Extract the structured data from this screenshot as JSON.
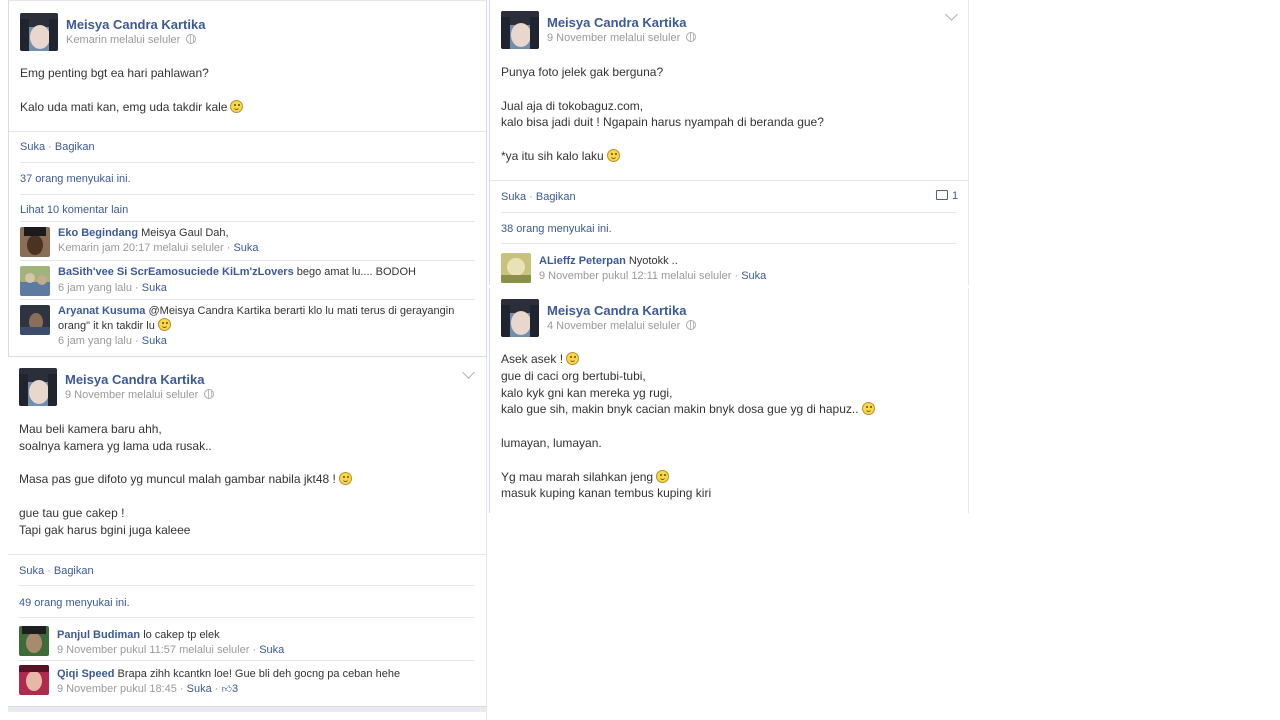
{
  "posts": [
    {
      "author": "Meisya Candra Kartika",
      "meta": "Kemarin melalui seluler",
      "lines": [
        "Emg penting bgt ea hari pahlawan?",
        "",
        "Kalo uda mati kan, emg uda takdir kale"
      ],
      "actions": {
        "like": "Suka",
        "sep": " · ",
        "share": "Bagikan"
      },
      "likes": "37 orang menyukai ini.",
      "view_more": "Lihat 10 komentar lain",
      "comments": [
        {
          "name": "Eko Begindang",
          "text": "Meisya Gaul Dah,",
          "meta": "Kemarin jam 20:17 melalui seluler",
          "like": "Suka"
        },
        {
          "name": "BaSith'vee Si ScrEamosuciede KiLm'zLovers",
          "text": "bego amat lu.... BODOH",
          "meta": "6 jam yang lalu",
          "like": "Suka"
        },
        {
          "name": "Aryanat Kusuma",
          "text": "@Meisya Candra Kartika berarti klo lu mati terus di gerayangin orang\" it kn takdir lu",
          "meta": "6 jam yang lalu",
          "like": "Suka"
        }
      ]
    },
    {
      "author": "Meisya Candra Kartika",
      "meta": "9 November melalui seluler",
      "lines": [
        "Punya foto jelek gak berguna?",
        "",
        "Jual aja di tokobaguz.com,",
        "kalo bisa jadi duit ! Ngapain harus nyampah di beranda gue?",
        "",
        "*ya itu sih kalo laku"
      ],
      "actions": {
        "like": "Suka",
        "sep": " · ",
        "share": "Bagikan"
      },
      "comment_count": "1",
      "likes": "38 orang menyukai ini.",
      "comments": [
        {
          "name": "ALieffz Peterpan",
          "text": "Nyotokk ..",
          "meta": "9 November pukul 12:11 melalui seluler",
          "like": "Suka"
        }
      ]
    },
    {
      "author": "Meisya Candra Kartika",
      "meta": "9 November melalui seluler",
      "lines": [
        "Mau beli kamera baru ahh,",
        "soalnya kamera yg lama uda rusak..",
        "",
        "Masa pas gue difoto yg muncul malah gambar nabila jkt48 !",
        "",
        "gue tau gue cakep !",
        "Tapi gak harus bgini juga kaleee"
      ],
      "actions": {
        "like": "Suka",
        "sep": " · ",
        "share": "Bagikan"
      },
      "likes": "49 orang menyukai ini.",
      "comments": [
        {
          "name": "Panjul Budiman",
          "text": "lo cakep tp elek",
          "meta": "9 November pukul 11:57 melalui seluler",
          "like": "Suka"
        },
        {
          "name": "Qiqi Speed",
          "text": "Brapa zihh kcantkn loe! Gue bli deh gocng pa ceban hehe",
          "meta": "9 November pukul 18:45",
          "like": "Suka",
          "like_count": "3"
        }
      ]
    },
    {
      "author": "Meisya Candra Kartika",
      "meta": "4 November melalui seluler",
      "lines": [
        "Asek asek !",
        "gue di caci org bertubi-tubi,",
        "kalo kyk gni kan mereka yg rugi,",
        "kalo gue sih, makin bnyk cacian makin bnyk dosa gue yg di hapuz..",
        "",
        "lumayan, lumayan.",
        "",
        "Yg mau marah silahkan jeng",
        "masuk kuping kanan tembus kuping kiri"
      ]
    }
  ],
  "colors": {
    "link": "#3b5998",
    "meta": "#999999",
    "text": "#333333",
    "border": "#d8dce6"
  },
  "icons": {
    "privacy": "globe-icon",
    "menu": "chevron-down-icon",
    "emoticon": "smiley-icon",
    "comment": "comment-icon",
    "like": "thumbs-up-icon"
  }
}
